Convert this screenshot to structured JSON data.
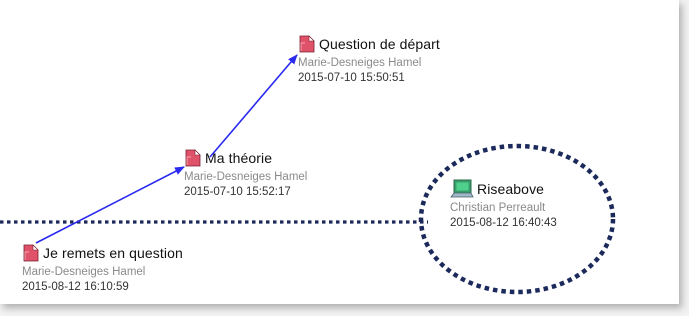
{
  "colors": {
    "link_arrow": "#2a2af0",
    "dotted_marker": "#1b2a5a",
    "note_icon_red": "#e0526a",
    "riseabove_icon_green": "#3ea873"
  },
  "notes": [
    {
      "title": "Question de départ",
      "author": "Marie-Desneiges Hamel",
      "date": "2015-07-10 15:50:51",
      "icon": "note-page-icon"
    },
    {
      "title": "Ma théorie",
      "author": "Marie-Desneiges Hamel",
      "date": "2015-07-10 15:52:17",
      "icon": "note-page-icon"
    },
    {
      "title": "Je remets en question",
      "author": "Marie-Desneiges Hamel",
      "date": "2015-08-12 16:10:59",
      "icon": "note-page-icon"
    },
    {
      "title": "Riseabove",
      "author": "Christian Perreault",
      "date": "2015-08-12 16:40:43",
      "icon": "riseabove-laptop-icon"
    }
  ]
}
